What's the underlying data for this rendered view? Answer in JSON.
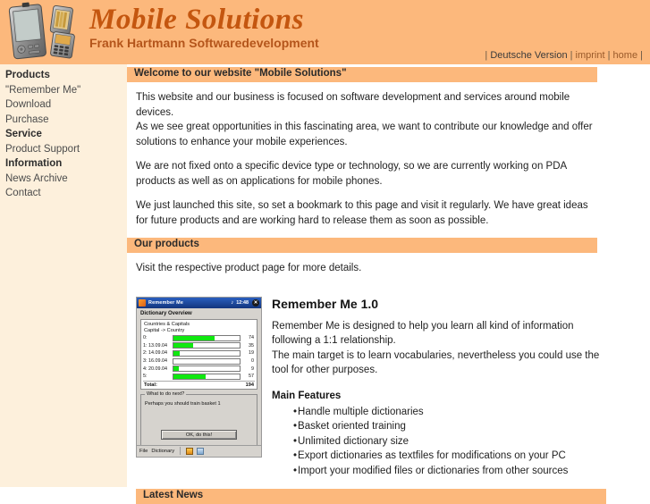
{
  "header": {
    "logo_icon": "pda-and-phone-image",
    "brand_title": "Mobile Solutions",
    "brand_subtitle": "Frank Hartmann Softwaredevelopment",
    "topnav": {
      "open": "|",
      "items": [
        {
          "label": "Deutsche Version",
          "style": "de"
        },
        {
          "label": "imprint",
          "style": "other"
        },
        {
          "label": "home",
          "style": "other"
        }
      ],
      "separator": "|",
      "close": "|"
    }
  },
  "sidebar": {
    "items": [
      {
        "label": "Products",
        "heading": true
      },
      {
        "label": "\"Remember Me\"",
        "heading": false
      },
      {
        "label": "Download",
        "heading": false
      },
      {
        "label": "Purchase",
        "heading": false
      },
      {
        "label": "Service",
        "heading": true
      },
      {
        "label": "Product Support",
        "heading": false
      },
      {
        "label": "Information",
        "heading": true
      },
      {
        "label": "News Archive",
        "heading": false
      },
      {
        "label": "Contact",
        "heading": false
      }
    ]
  },
  "welcome": {
    "bar_title": "Welcome to our website \"Mobile Solutions\"",
    "paragraphs": [
      "This website and our business is focused on software development and services around mobile devices.\nAs we see great opportunities in this fascinating area, we want to contribute our knowledge and offer solutions to enhance your mobile experiences.",
      "We are not fixed onto a specific device type or technology, so we are currently working on PDA products as well as on applications for mobile phones.",
      "We just launched this site, so set a bookmark to this page and visit it regularly. We have great ideas for future products and are working hard to release them as soon as possible."
    ]
  },
  "products": {
    "bar_title": "Our products",
    "intro": "Visit the respective product page for more details.",
    "item": {
      "title": "Remember Me 1.0",
      "description": "Remember Me is designed to help you learn all kind of information following a 1:1 relationship.\nThe main target is to learn vocabularies, nevertheless you could use the tool for other purposes.",
      "features_title": "Main Features",
      "features": [
        "Handle multiple dictionaries",
        "Basket oriented training",
        "Unlimited dictionary size",
        "Export dictionaries as textfiles for modifications on your PC",
        "Import your modified files or dictionaries from other sources"
      ],
      "screenshot": {
        "window_title": "Remember Me",
        "clock": "12:48",
        "speaker_icon": "speaker-icon",
        "close_icon": "close-icon",
        "page_heading": "Dictionary Overview",
        "dictionary_name": "Countries & Capitals",
        "direction": "Capital -> Country",
        "rows": [
          {
            "label": "0:",
            "value": "74",
            "pct": 62
          },
          {
            "label": "1: 13.09.04",
            "value": "35",
            "pct": 30
          },
          {
            "label": "2: 14.09.04",
            "value": "19",
            "pct": 9
          },
          {
            "label": "3: 16.09.04",
            "value": "0",
            "pct": 0
          },
          {
            "label": "4: 20.09.04",
            "value": "9",
            "pct": 8
          },
          {
            "label": "5:",
            "value": "57",
            "pct": 48
          }
        ],
        "total_label": "Total:",
        "total_value": "194",
        "hint_legend": "What to do next?",
        "hint_message": "Perhaps you should train basket 1",
        "hint_button": "OK, do this!",
        "taskbar": {
          "file": "File",
          "dictionary": "Dictionary",
          "icon1": "person-icon",
          "icon2": "folder-icon"
        }
      }
    }
  },
  "news": {
    "bar_title": "Latest News"
  },
  "colors": {
    "accent_orange": "#fcb87c",
    "sidebar_cream": "#fdf0dc",
    "brand_title": "#c4560f",
    "brand_sub": "#b4551b",
    "bar_green": "#10e810",
    "pda_titlebar": "#17408f"
  }
}
